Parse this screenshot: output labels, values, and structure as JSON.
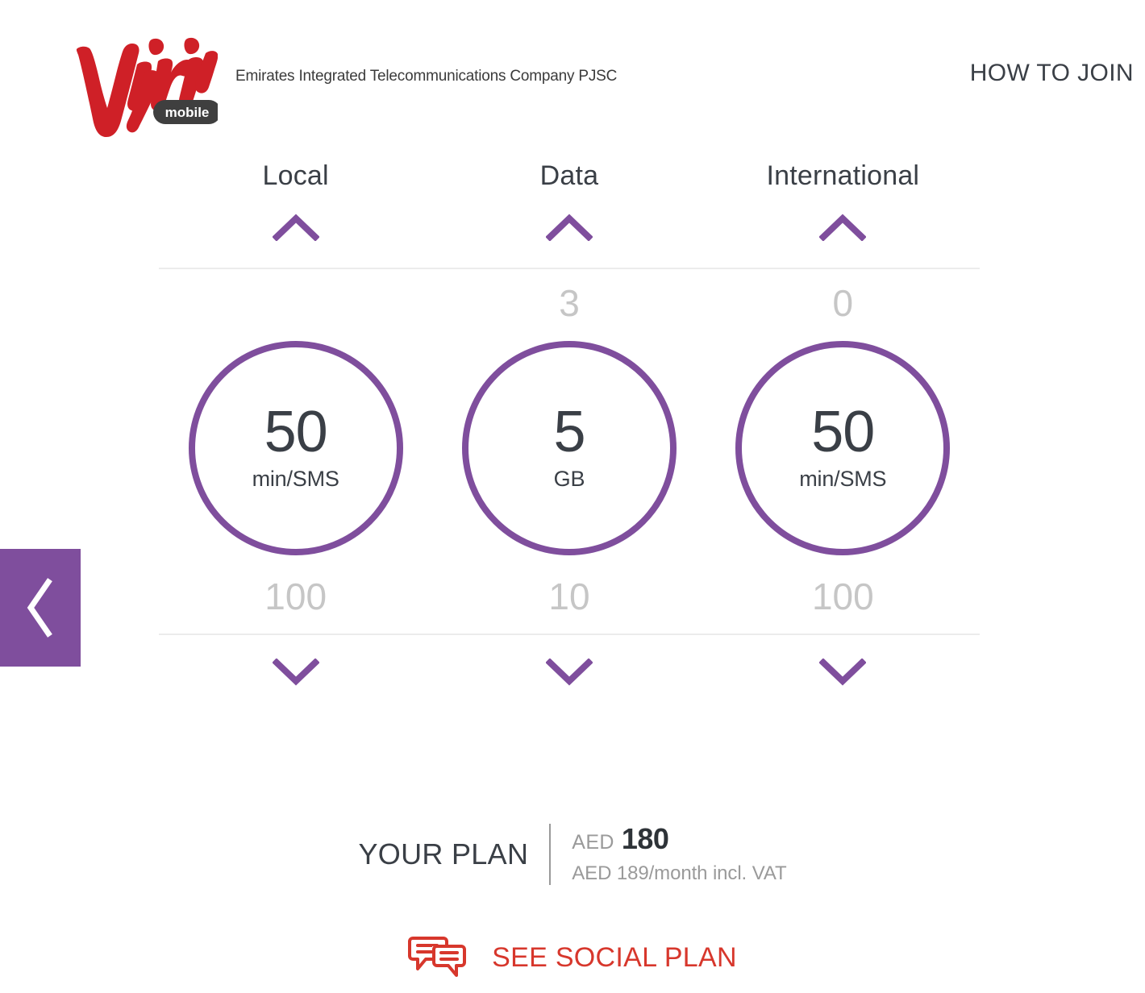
{
  "header": {
    "logo_name": "virgin-mobile-logo",
    "logo_word": "Virgin",
    "logo_badge": "mobile",
    "company_name": "Emirates Integrated Telecommunications Company PJSC",
    "how_to_join": "HOW TO JOIN"
  },
  "nav": {
    "prev_icon": "chevron-left-icon"
  },
  "colors": {
    "purple": "#7f4e9d",
    "red": "#d7372c",
    "dark_text": "#3a3f46",
    "muted_grey": "#c6c6c6",
    "divider": "#ececec"
  },
  "builder": {
    "columns": [
      {
        "title": "Local",
        "up_icon": "chevron-up-icon",
        "down_icon": "chevron-down-icon",
        "value_above": "",
        "amount": "50",
        "unit": "min/SMS",
        "value_below": "100"
      },
      {
        "title": "Data",
        "up_icon": "chevron-up-icon",
        "down_icon": "chevron-down-icon",
        "value_above": "3",
        "amount": "5",
        "unit": "GB",
        "value_below": "10"
      },
      {
        "title": "International",
        "up_icon": "chevron-up-icon",
        "down_icon": "chevron-down-icon",
        "value_above": "0",
        "amount": "50",
        "unit": "min/SMS",
        "value_below": "100"
      }
    ]
  },
  "your_plan": {
    "label": "YOUR PLAN",
    "currency": "AED",
    "price": "180",
    "sub": "AED 189/month incl. VAT"
  },
  "social": {
    "icon": "chat-bubbles-icon",
    "label": "SEE SOCIAL PLAN"
  }
}
